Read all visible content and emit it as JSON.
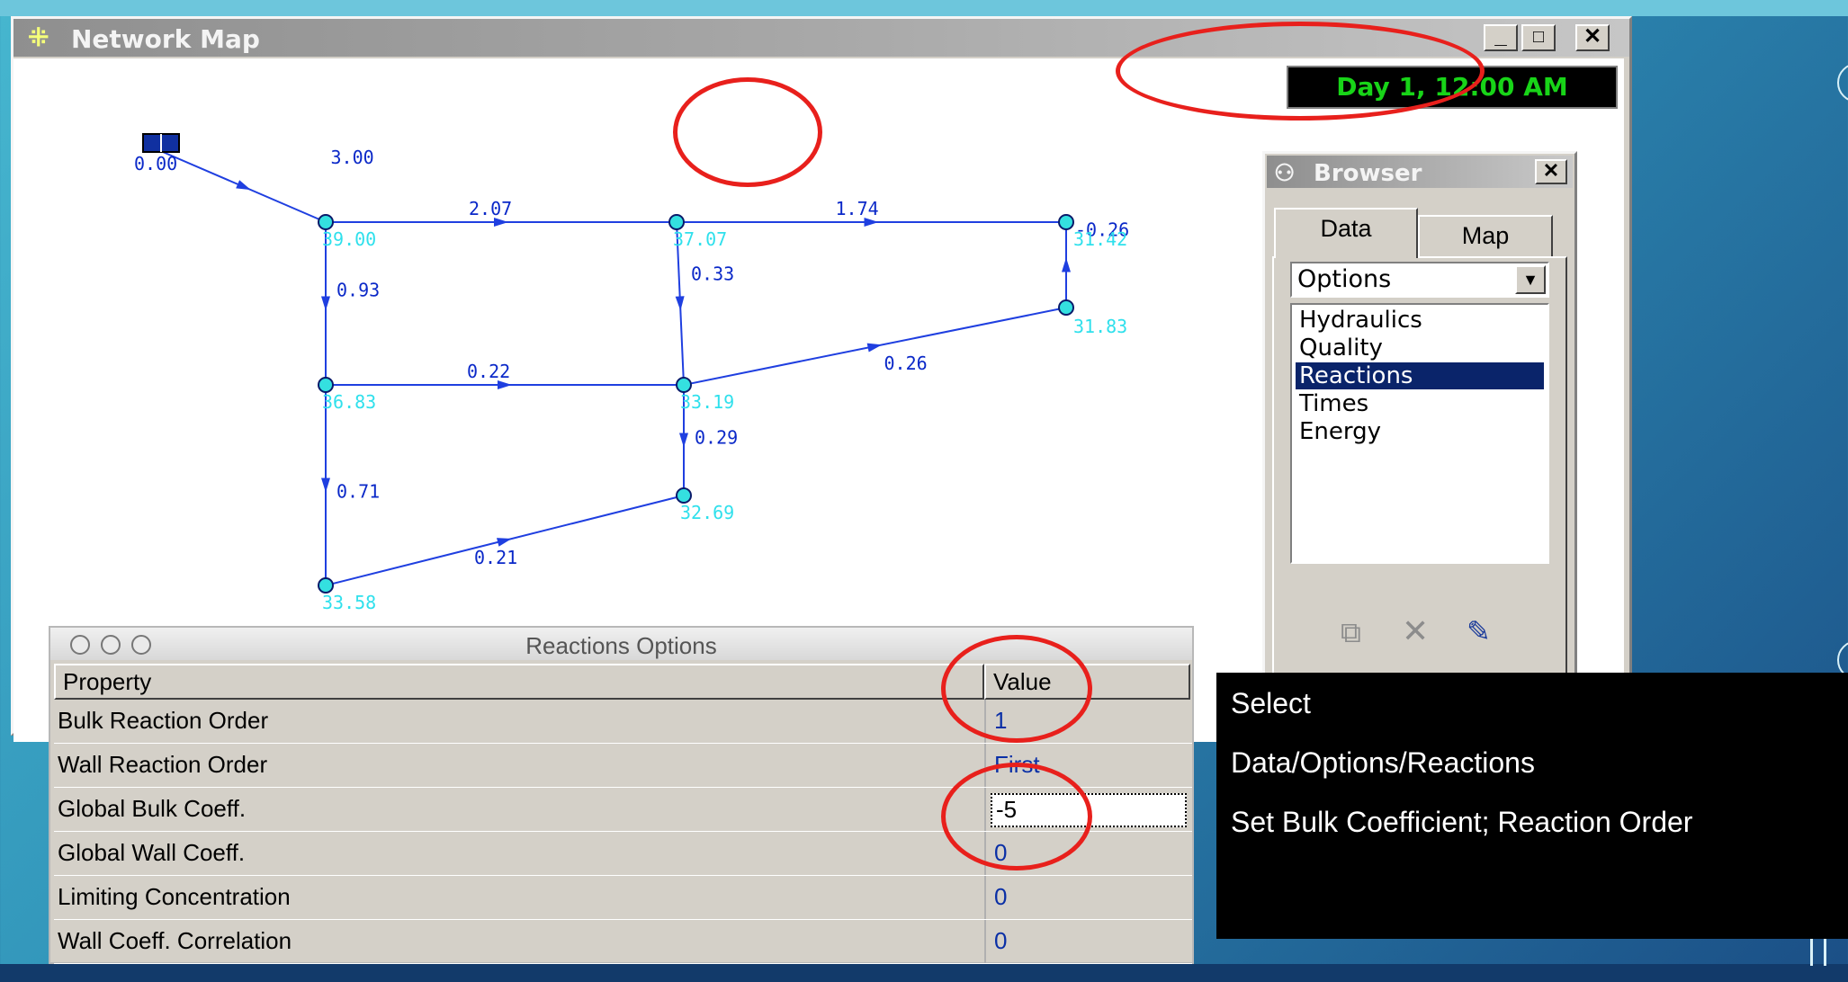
{
  "window": {
    "title": "Network Map",
    "icon": "network-map-icon",
    "controls": {
      "minimize": "_",
      "maximize": "□",
      "close": "✕"
    },
    "time_display": "Day 1, 12:00 AM"
  },
  "network": {
    "reservoir_head": "0.00",
    "nodes": [
      {
        "id": "n1",
        "label": "39.00"
      },
      {
        "id": "n2",
        "label": "37.07"
      },
      {
        "id": "n3",
        "label": "31.42"
      },
      {
        "id": "n4",
        "label": "31.83"
      },
      {
        "id": "n5",
        "label": "36.83"
      },
      {
        "id": "n6",
        "label": "33.19"
      },
      {
        "id": "n7",
        "label": "32.69"
      },
      {
        "id": "n8",
        "label": "33.58"
      }
    ],
    "links": [
      {
        "id": "l0",
        "from": "res",
        "to": "n1",
        "label": "3.00"
      },
      {
        "id": "l1",
        "from": "n1",
        "to": "n2",
        "label": "2.07"
      },
      {
        "id": "l2",
        "from": "n2",
        "to": "n3",
        "label": "1.74"
      },
      {
        "id": "l3",
        "from": "n1",
        "to": "n5",
        "label": "0.93"
      },
      {
        "id": "l4",
        "from": "n2",
        "to": "n6",
        "label": "0.33"
      },
      {
        "id": "l5",
        "from": "n4",
        "to": "n3",
        "label": "-0.26"
      },
      {
        "id": "l6",
        "from": "n6",
        "to": "n4",
        "label": "0.26"
      },
      {
        "id": "l7",
        "from": "n5",
        "to": "n6",
        "label": "0.22"
      },
      {
        "id": "l8",
        "from": "n6",
        "to": "n7",
        "label": "0.29"
      },
      {
        "id": "l9",
        "from": "n5",
        "to": "n8",
        "label": "0.71"
      },
      {
        "id": "l10",
        "from": "n8",
        "to": "n7",
        "label": "0.21"
      }
    ]
  },
  "browser": {
    "title": "Browser",
    "close": "✕",
    "tabs": [
      {
        "label": "Data",
        "active": true
      },
      {
        "label": "Map",
        "active": false
      }
    ],
    "category_select": "Options",
    "items": [
      "Hydraulics",
      "Quality",
      "Reactions",
      "Times",
      "Energy"
    ],
    "selected_item": "Reactions",
    "toolbar": [
      "add-icon",
      "delete-icon",
      "edit-icon"
    ]
  },
  "reactions_options": {
    "title": "Reactions Options",
    "columns": {
      "property": "Property",
      "value": "Value"
    },
    "rows": [
      {
        "property": "Bulk Reaction Order",
        "value": "1"
      },
      {
        "property": "Wall Reaction Order",
        "value": "First"
      },
      {
        "property": "Global Bulk Coeff.",
        "value": "-5"
      },
      {
        "property": "Global Wall Coeff.",
        "value": "0"
      },
      {
        "property": "Limiting Concentration",
        "value": "0"
      },
      {
        "property": "Wall Coeff. Correlation",
        "value": "0"
      }
    ]
  },
  "callout": {
    "lines": [
      "Select",
      "Data/Options/Reactions",
      "Set Bulk Coefficient; Reaction Order"
    ]
  },
  "colors": {
    "node_fill": "#34e0e0",
    "link": "#1f3fe0",
    "node_label": "#2fe0ec",
    "link_label": "#0a28c8",
    "selection": "#0a246a",
    "annotation": "#e8201c",
    "clock_text": "#18d418"
  }
}
